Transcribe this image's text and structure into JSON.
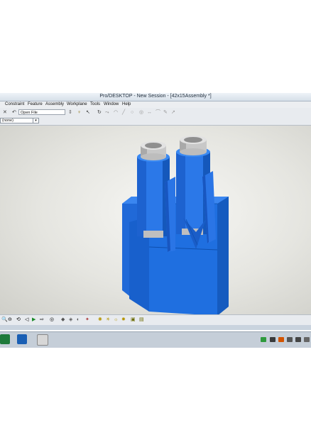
{
  "window": {
    "title": "Pro/DESKTOP - New Session - [42x15Assembly *]"
  },
  "menu": [
    "Constraint",
    "Feature",
    "Assembly",
    "Workplane",
    "Tools",
    "Window",
    "Help"
  ],
  "toolbar": {
    "open_file_label": "Open File"
  },
  "selection": {
    "value": "(none)"
  },
  "colors": {
    "model_blue": "#1f6fe0",
    "metal": "#c8c8c8"
  },
  "icons": {
    "toolbar": [
      "close-icon",
      "undo-icon",
      "pin-icon",
      "key-icon",
      "pointer-icon",
      "rotate-icon",
      "line-icon",
      "arc-icon",
      "circle-icon",
      "sketch-icon",
      "constraint-icon",
      "dimension-icon"
    ],
    "bottombar": [
      "zoom-in-icon",
      "zoom-out-icon",
      "pan-icon",
      "rotate-view-icon",
      "play-icon",
      "arrow-icon",
      "view-icon",
      "render-icon",
      "material-icon",
      "light-icon"
    ],
    "taskbar": [
      "excel-icon",
      "outlook-icon",
      "prodesktop-icon"
    ],
    "tray": [
      "network-icon",
      "volume-icon",
      "battery-icon",
      "cloud-icon",
      "shield-icon"
    ]
  }
}
